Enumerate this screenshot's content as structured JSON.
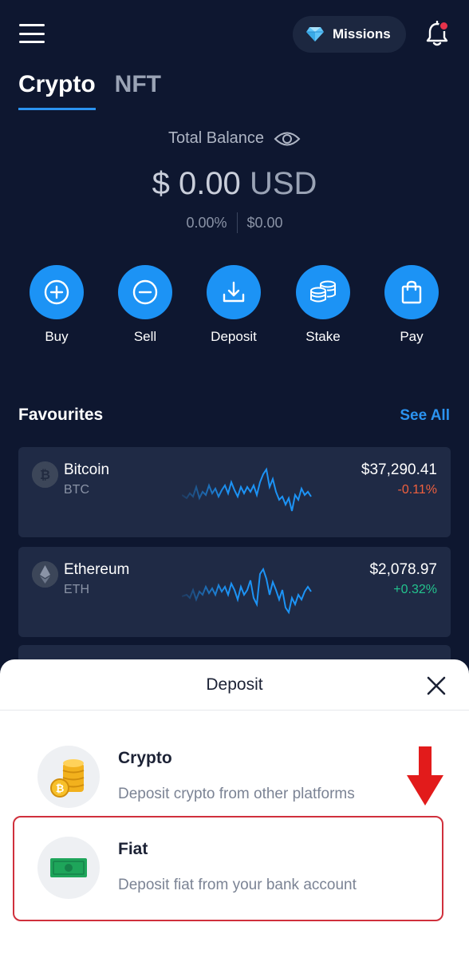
{
  "header": {
    "menu_icon": "hamburger-menu-icon",
    "missions_label": "Missions",
    "missions_icon": "diamond-icon",
    "bell_icon": "bell-icon",
    "notification_dot_color": "#e5334b"
  },
  "tabs": [
    {
      "label": "Crypto",
      "active": true
    },
    {
      "label": "NFT",
      "active": false
    }
  ],
  "balance": {
    "label": "Total Balance",
    "visibility_icon": "eye-icon",
    "amount": "$ 0.00",
    "currency": "USD",
    "change_percent": "0.00%",
    "change_value": "$0.00"
  },
  "actions": [
    {
      "label": "Buy",
      "icon": "plus-circle-icon"
    },
    {
      "label": "Sell",
      "icon": "minus-circle-icon"
    },
    {
      "label": "Deposit",
      "icon": "download-icon"
    },
    {
      "label": "Stake",
      "icon": "coin-stack-icon"
    },
    {
      "label": "Pay",
      "icon": "shopping-bag-icon"
    }
  ],
  "favourites": {
    "title": "Favourites",
    "see_all": "See All",
    "items": [
      {
        "name": "Bitcoin",
        "symbol": "BTC",
        "price": "$37,290.41",
        "change": "-0.11%",
        "change_color": "#f0603e",
        "icon": "bitcoin-icon"
      },
      {
        "name": "Ethereum",
        "symbol": "ETH",
        "price": "$2,078.97",
        "change": "+0.32%",
        "change_color": "#23c38e",
        "icon": "ethereum-icon"
      }
    ]
  },
  "deposit_sheet": {
    "title": "Deposit",
    "close_icon": "close-icon",
    "options": [
      {
        "title": "Crypto",
        "description": "Deposit crypto from other platforms",
        "icon": "gold-coins-icon"
      },
      {
        "title": "Fiat",
        "description": "Deposit fiat from your bank account",
        "icon": "banknote-icon"
      }
    ],
    "annotation_arrow": "red-down-arrow-icon",
    "highlight_color": "#d0303c"
  },
  "colors": {
    "background": "#0e1730",
    "accent": "#1c93f5",
    "card": "#1f2a45"
  }
}
